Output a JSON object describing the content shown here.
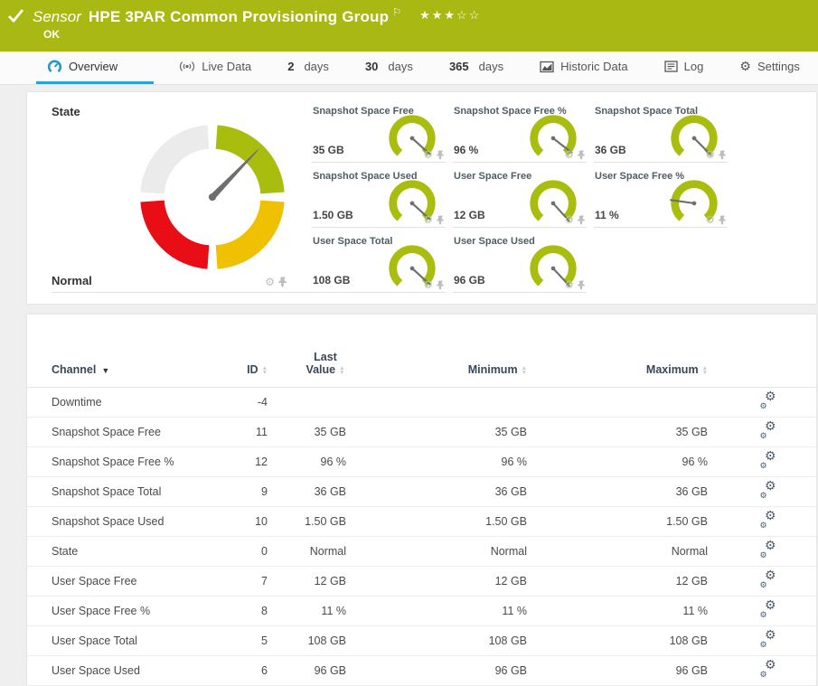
{
  "header": {
    "kind": "Sensor",
    "title": "HPE 3PAR Common Provisioning Group",
    "status": "OK",
    "stars_filled": 3,
    "stars_total": 5,
    "bar_color": "#aab814"
  },
  "tabs": {
    "overview": "Overview",
    "live_data": "Live Data",
    "d2_num": "2",
    "d2_label": "days",
    "d30_num": "30",
    "d30_label": "days",
    "d365_num": "365",
    "d365_label": "days",
    "historic": "Historic Data",
    "log": "Log",
    "settings": "Settings",
    "active_tab": "Overview",
    "accent_color": "#2aa3da"
  },
  "state_panel": {
    "title": "State",
    "value": "Normal",
    "needle_deg": 46,
    "segment_colors": {
      "ok": "#a9bd0e",
      "warning": "#f0c002",
      "error": "#e90d16",
      "none": "#ebebeb"
    }
  },
  "gauges": [
    {
      "name": "Snapshot Space Free",
      "value": "35 GB",
      "needle_deg": -42
    },
    {
      "name": "Snapshot Space Free %",
      "value": "96 %",
      "needle_deg": -38
    },
    {
      "name": "Snapshot Space Total",
      "value": "36 GB",
      "needle_deg": -45
    },
    {
      "name": "Snapshot Space Used",
      "value": "1.50 GB",
      "needle_deg": -42
    },
    {
      "name": "User Space Free",
      "value": "12 GB",
      "needle_deg": -48
    },
    {
      "name": "User Space Free %",
      "value": "11 %",
      "needle_deg": 172
    },
    {
      "name": "User Space Total",
      "value": "108 GB",
      "needle_deg": -42
    },
    {
      "name": "User Space Used",
      "value": "96 GB",
      "needle_deg": -47
    }
  ],
  "gauge_color": "#a9bd0e",
  "table": {
    "columns": {
      "channel": "Channel",
      "id": "ID",
      "last": "Last Value",
      "min": "Minimum",
      "max": "Maximum"
    },
    "rows": [
      {
        "channel": "Downtime",
        "id": "-4",
        "last": "",
        "min": "",
        "max": ""
      },
      {
        "channel": "Snapshot Space Free",
        "id": "11",
        "last": "35 GB",
        "min": "35 GB",
        "max": "35 GB"
      },
      {
        "channel": "Snapshot Space Free %",
        "id": "12",
        "last": "96 %",
        "min": "96 %",
        "max": "96 %"
      },
      {
        "channel": "Snapshot Space Total",
        "id": "9",
        "last": "36 GB",
        "min": "36 GB",
        "max": "36 GB"
      },
      {
        "channel": "Snapshot Space Used",
        "id": "10",
        "last": "1.50 GB",
        "min": "1.50 GB",
        "max": "1.50 GB"
      },
      {
        "channel": "State",
        "id": "0",
        "last": "Normal",
        "min": "Normal",
        "max": "Normal"
      },
      {
        "channel": "User Space Free",
        "id": "7",
        "last": "12 GB",
        "min": "12 GB",
        "max": "12 GB"
      },
      {
        "channel": "User Space Free %",
        "id": "8",
        "last": "11 %",
        "min": "11 %",
        "max": "11 %"
      },
      {
        "channel": "User Space Total",
        "id": "5",
        "last": "108 GB",
        "min": "108 GB",
        "max": "108 GB"
      },
      {
        "channel": "User Space Used",
        "id": "6",
        "last": "96 GB",
        "min": "96 GB",
        "max": "96 GB"
      }
    ]
  }
}
